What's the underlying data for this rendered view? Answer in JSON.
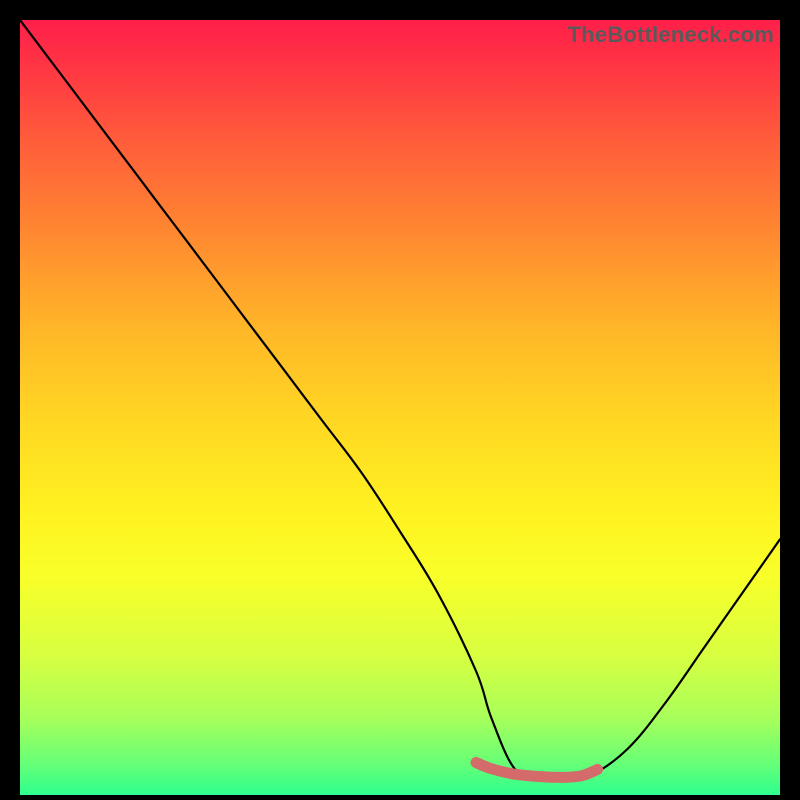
{
  "watermark": "TheBottleneck.com",
  "chart_data": {
    "type": "line",
    "title": "",
    "xlabel": "",
    "ylabel": "",
    "xlim": [
      0,
      100
    ],
    "ylim": [
      0,
      100
    ],
    "background": "gradient-red-to-green",
    "series": [
      {
        "name": "bottleneck-curve",
        "color": "#000000",
        "x": [
          0,
          5,
          10,
          15,
          20,
          25,
          30,
          35,
          40,
          45,
          50,
          55,
          60,
          62,
          65,
          68,
          70,
          72,
          75,
          80,
          85,
          90,
          95,
          100
        ],
        "y": [
          100,
          93.5,
          87,
          80.5,
          74,
          67.5,
          61,
          54.5,
          48,
          41.5,
          34,
          26,
          16,
          10,
          3.5,
          2.5,
          2.3,
          2.3,
          2.5,
          6,
          12,
          19,
          26,
          33
        ]
      },
      {
        "name": "optimal-flat-marker",
        "color": "#e06666",
        "x": [
          60,
          62,
          65,
          68,
          70,
          72,
          74,
          76
        ],
        "y": [
          4.2,
          3.4,
          2.7,
          2.4,
          2.3,
          2.3,
          2.5,
          3.3
        ]
      }
    ]
  }
}
